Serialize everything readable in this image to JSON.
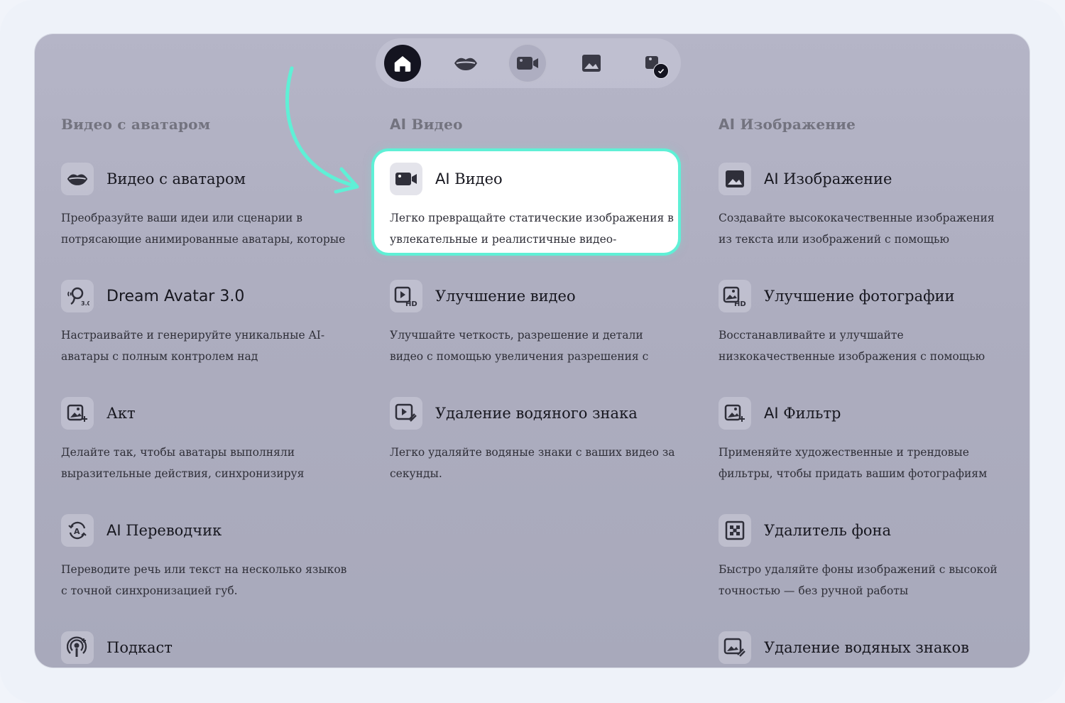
{
  "columns": [
    {
      "title": "Видео с аватаром"
    },
    {
      "title_ai": "AI",
      "title_rest": " Видео"
    },
    {
      "title_ai": "AI",
      "title_rest": " Изображение"
    }
  ],
  "col1": [
    {
      "title": "Видео с аватаром",
      "desc": "Преобразуйте ваши идеи или сценарии в потрясающие анимированные аватары, которые",
      "icon": "lips-icon"
    },
    {
      "title": "Dream Avatar 3.0",
      "desc": "Настраивайте и генерируйте уникальные AI-аватары с полным контролем над",
      "icon": "dream-avatar-icon"
    },
    {
      "title": "Акт",
      "desc": "Делайте так, чтобы аватары выполняли выразительные действия, синхронизируя движение",
      "icon": "act-icon"
    },
    {
      "title_ai": "AI",
      "title_rest": " Переводчик",
      "desc": "Переводите речь или текст на несколько языков с точной синхронизацией губ.",
      "icon": "translate-icon"
    },
    {
      "title": "Подкаст",
      "icon": "podcast-icon"
    }
  ],
  "col2": [
    {
      "title_ai": "AI",
      "title_rest": " Видео",
      "desc": "Легко превращайте статические изображения в увлекательные и реалистичные видео-анимации.",
      "icon": "video-camera-icon"
    },
    {
      "title": "Улучшение видео",
      "desc": "Улучшайте четкость, разрешение и детали видео с помощью увеличения разрешения с",
      "icon": "video-hd-icon",
      "badge": "HD"
    },
    {
      "title": "Удаление водяного знака",
      "desc": "Легко удаляйте водяные знаки с ваших видео за секунды.",
      "icon": "video-watermark-icon"
    }
  ],
  "col3": [
    {
      "title_ai": "AI",
      "title_rest": " Изображение",
      "desc": "Создавайте высококачественные изображения из текста или изображений с помощью передовых",
      "icon": "image-icon"
    },
    {
      "title": "Улучшение фотографии",
      "desc": "Восстанавливайте и улучшайте низкокачественные изображения с помощью интеллектуальных",
      "icon": "photo-hd-icon",
      "badge": "HD"
    },
    {
      "title_ai": "AI",
      "title_rest": " Фильтр",
      "desc": "Применяйте художественные и трендовые фильтры, чтобы придать вашим фотографиям",
      "icon": "filter-icon"
    },
    {
      "title": "Удалитель фона",
      "desc": "Быстро удаляйте фоны изображений с высокой точностью — без ручной работы",
      "icon": "background-remover-icon"
    },
    {
      "title": "Удаление водяных знаков",
      "icon": "image-watermark-icon"
    }
  ],
  "colors": {
    "highlight_border": "#5ff0d6",
    "arrow": "#5ff0d6",
    "home_active": "#141420"
  }
}
